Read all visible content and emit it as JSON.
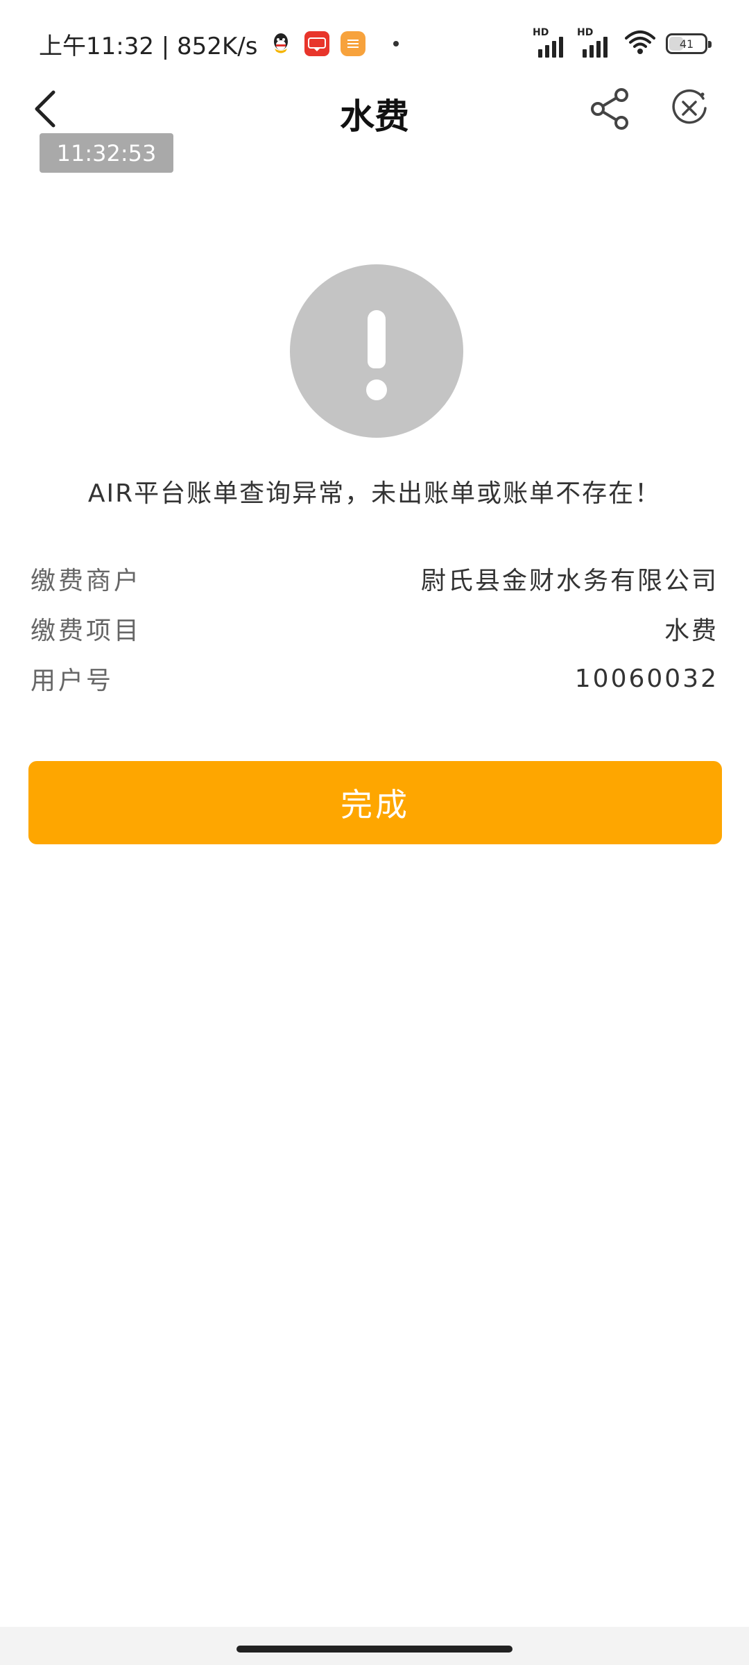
{
  "status_bar": {
    "time_text": "上午11:32 | 852K/s",
    "battery_level": 41,
    "battery_text": "41",
    "signal_label_1": "HD",
    "signal_label_2": "HD",
    "app_icons": [
      "qq-icon",
      "red-app-icon",
      "orange-app-icon"
    ]
  },
  "nav": {
    "title": "水费",
    "back_icon": "chevron-left-icon",
    "share_icon": "share-icon",
    "close_icon": "close-circle-icon"
  },
  "time_badge": "11:32:53",
  "warning": {
    "icon": "exclamation-icon",
    "message": "AIR平台账单查询异常，未出账单或账单不存在！"
  },
  "info": {
    "merchant_label": "缴费商户",
    "merchant_value": "尉氏县金财水务有限公司",
    "item_label": "缴费项目",
    "item_value": "水费",
    "account_label": "用户号",
    "account_value": "10060032"
  },
  "done_button_label": "完成",
  "colors": {
    "accent": "#fea600",
    "warning_gray": "#c4c4c4",
    "badge_gray": "#a9a9a9"
  }
}
